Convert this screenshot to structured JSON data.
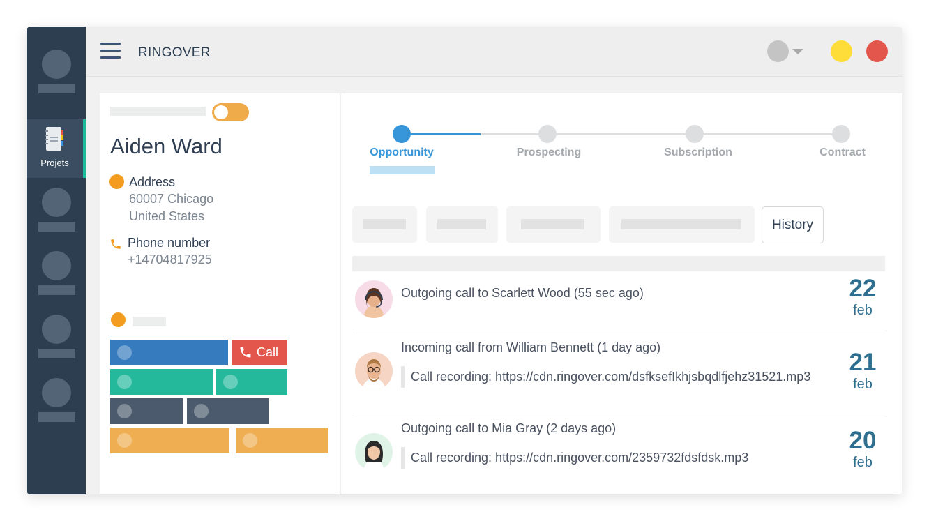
{
  "app": {
    "brand": "RINGOVER"
  },
  "sidebar": {
    "active_item_label": "Projets"
  },
  "contact": {
    "name": "Aiden Ward",
    "address_label": "Address",
    "address_line1": "60007 Chicago",
    "address_line2": "United States",
    "phone_label": "Phone number",
    "phone_value": "+14704817925",
    "call_label": "Call"
  },
  "pipeline": {
    "steps": [
      {
        "label": "Opportunity"
      },
      {
        "label": "Prospecting"
      },
      {
        "label": "Subscription"
      },
      {
        "label": "Contract"
      }
    ],
    "active_step": "Opportunity"
  },
  "tabs": {
    "history_label": "History"
  },
  "history": [
    {
      "text": "Outgoing call to Scarlett Wood (55 sec ago)",
      "recording": "",
      "day": "22",
      "month": "feb"
    },
    {
      "text": "Incoming call from William Bennett (1 day ago)",
      "recording": "Call recording: https://cdn.ringover.com/dsfksefIkhjsbqdlfjehz31521.mp3",
      "day": "21",
      "month": "feb"
    },
    {
      "text": "Outgoing call to Mia Gray (2 days ago)",
      "recording": "Call recording: https://cdn.ringover.com/2359732fdsfdsk.mp3",
      "day": "20",
      "month": "feb"
    }
  ],
  "colors": {
    "sidebar": "#2d3e50",
    "accent_blue": "#3696d9",
    "accent_teal": "#1dbb9c",
    "call_red": "#e3564b",
    "orange": "#f39c1f",
    "date_blue": "#2e6e8e"
  },
  "icons": [
    "menu-icon",
    "projects-notebook-icon",
    "phone-icon",
    "status-dot-icon",
    "chevron-down-icon"
  ]
}
